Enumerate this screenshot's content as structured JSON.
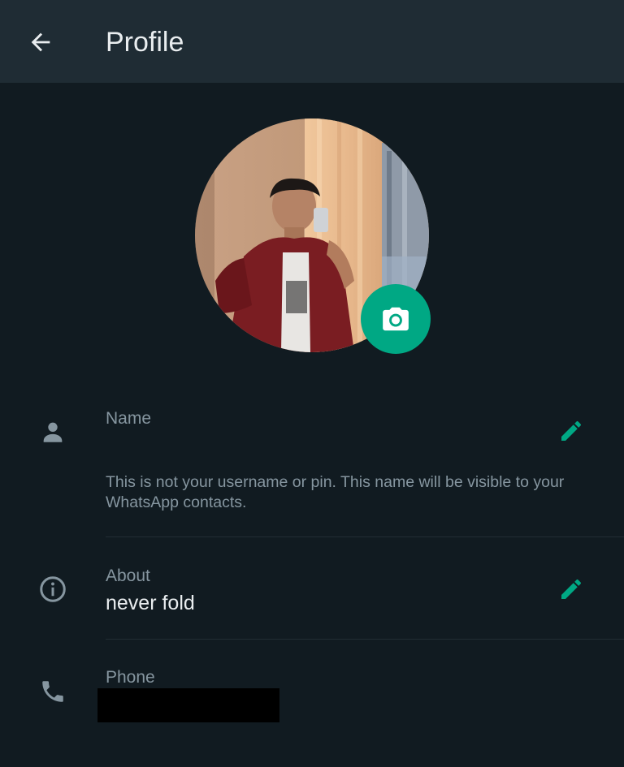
{
  "header": {
    "title": "Profile",
    "back_icon": "arrow-left-icon"
  },
  "colors": {
    "background": "#111b21",
    "appbar": "#1f2c34",
    "accent": "#00a884",
    "primary_text": "#e9edef",
    "secondary_text": "#8696a0"
  },
  "avatar": {
    "camera_icon": "camera-icon"
  },
  "name_row": {
    "icon": "person-icon",
    "label": "Name",
    "value": "",
    "helper": "This is not your username or pin. This name will be visible to your WhatsApp contacts.",
    "edit_icon": "pencil-icon"
  },
  "about_row": {
    "icon": "info-icon",
    "label": "About",
    "value": "never fold",
    "edit_icon": "pencil-icon"
  },
  "phone_row": {
    "icon": "phone-icon",
    "label": "Phone"
  }
}
